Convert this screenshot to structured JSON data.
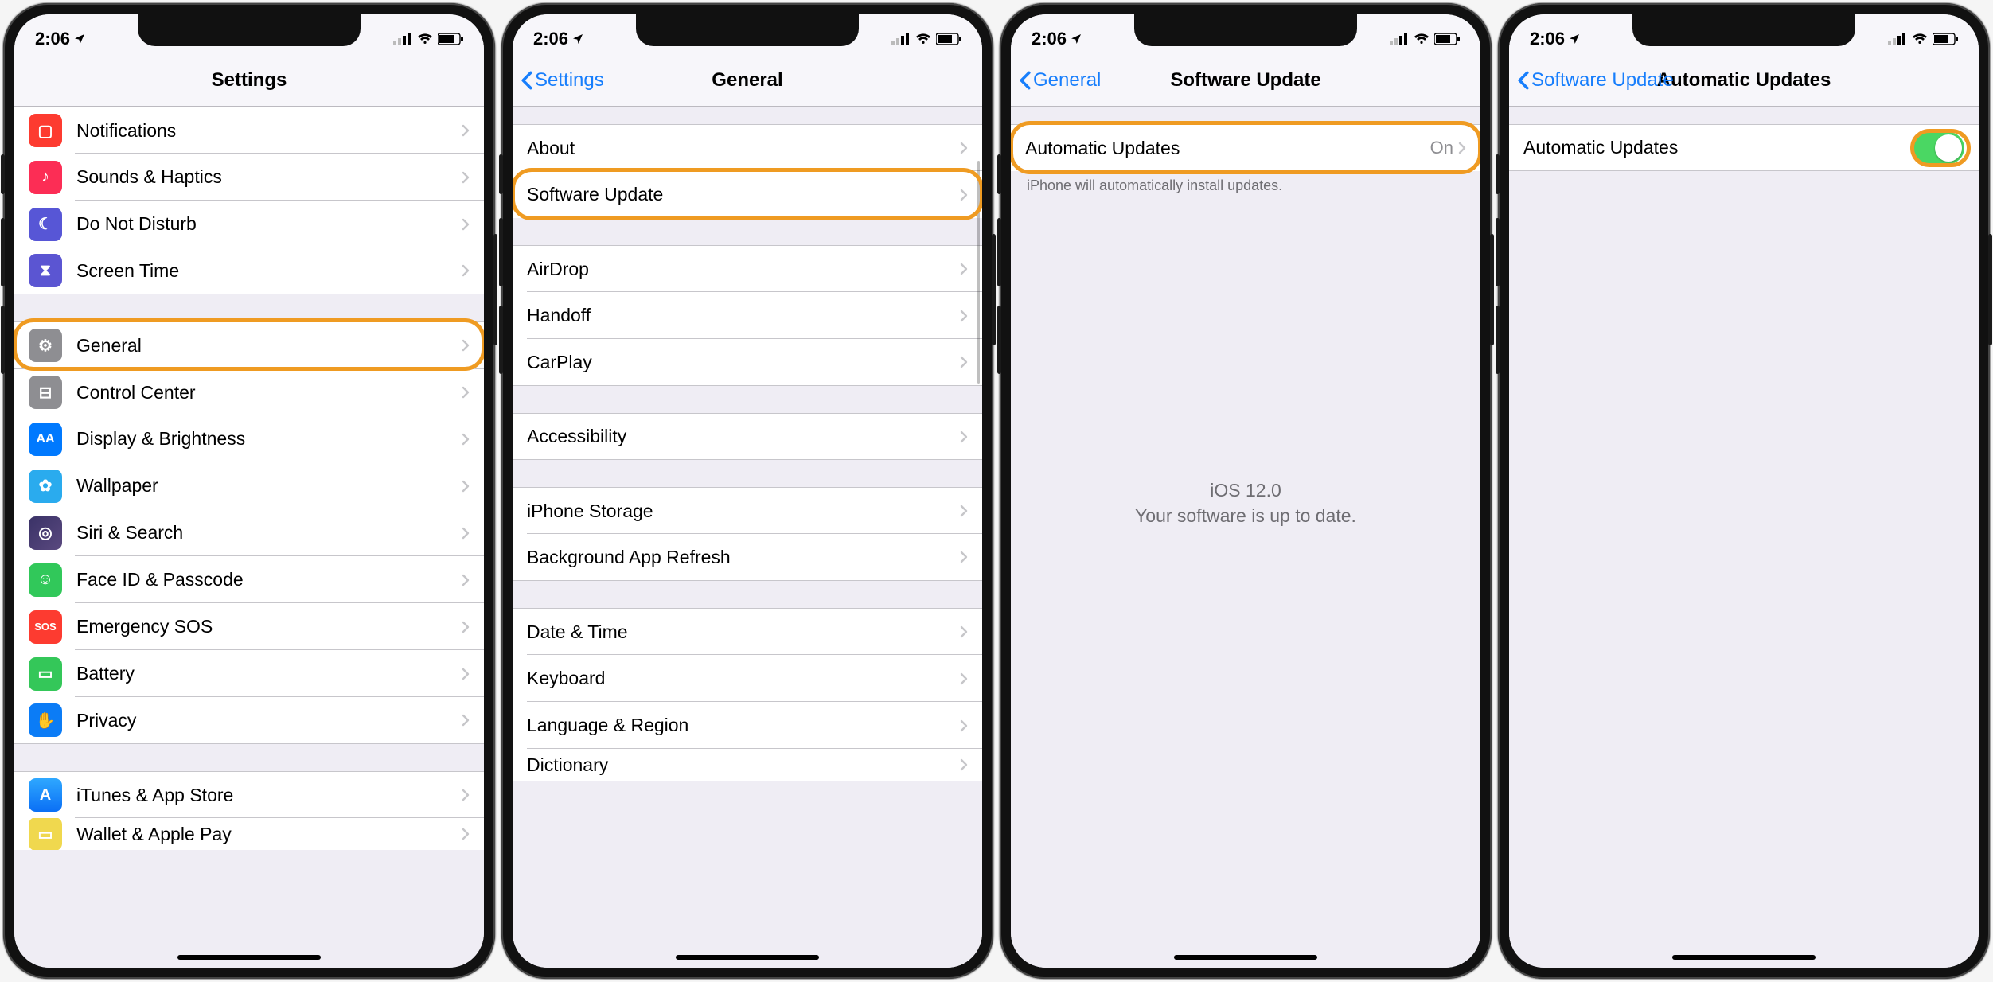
{
  "status": {
    "time": "2:06"
  },
  "screens": [
    {
      "title": "Settings",
      "back": null,
      "groups": [
        {
          "rows": [
            {
              "icon": "notifications-icon",
              "label": "Notifications",
              "color": "ic-red"
            },
            {
              "icon": "sounds-icon",
              "label": "Sounds & Haptics",
              "color": "ic-pink"
            },
            {
              "icon": "dnd-icon",
              "label": "Do Not Disturb",
              "color": "ic-purple"
            },
            {
              "icon": "screentime-icon",
              "label": "Screen Time",
              "color": "ic-purple2"
            }
          ]
        },
        {
          "rows": [
            {
              "icon": "general-icon",
              "label": "General",
              "color": "ic-gray",
              "highlight": true
            },
            {
              "icon": "control-icon",
              "label": "Control Center",
              "color": "ic-gray"
            },
            {
              "icon": "display-icon",
              "label": "Display & Brightness",
              "color": "ic-blue"
            },
            {
              "icon": "wallpaper-icon",
              "label": "Wallpaper",
              "color": "ic-cyan"
            },
            {
              "icon": "siri-icon",
              "label": "Siri & Search",
              "color": "ic-dkpurple"
            },
            {
              "icon": "faceid-icon",
              "label": "Face ID & Passcode",
              "color": "ic-green"
            },
            {
              "icon": "sos-icon",
              "label": "Emergency SOS",
              "color": "ic-red"
            },
            {
              "icon": "battery-icon",
              "label": "Battery",
              "color": "ic-green2"
            },
            {
              "icon": "privacy-icon",
              "label": "Privacy",
              "color": "ic-dkblue"
            }
          ]
        },
        {
          "rows": [
            {
              "icon": "appstore-icon",
              "label": "iTunes & App Store",
              "color": "ic-store"
            },
            {
              "icon": "wallet-icon",
              "label": "Wallet & Apple Pay",
              "color": "ic-sand",
              "cut": true
            }
          ]
        }
      ]
    },
    {
      "title": "General",
      "back": "Settings",
      "groups": [
        {
          "rows": [
            {
              "label": "About"
            },
            {
              "label": "Software Update",
              "highlight": true
            }
          ]
        },
        {
          "rows": [
            {
              "label": "AirDrop"
            },
            {
              "label": "Handoff"
            },
            {
              "label": "CarPlay"
            }
          ]
        },
        {
          "rows": [
            {
              "label": "Accessibility"
            }
          ]
        },
        {
          "rows": [
            {
              "label": "iPhone Storage"
            },
            {
              "label": "Background App Refresh"
            }
          ]
        },
        {
          "rows": [
            {
              "label": "Date & Time"
            },
            {
              "label": "Keyboard"
            },
            {
              "label": "Language & Region"
            },
            {
              "label": "Dictionary",
              "cut": true
            }
          ]
        }
      ],
      "scrollbar": true
    },
    {
      "title": "Software Update",
      "back": "General",
      "auto_row": {
        "label": "Automatic Updates",
        "value": "On",
        "highlight": true
      },
      "footer": "iPhone will automatically install updates.",
      "status_version": "iOS 12.0",
      "status_msg": "Your software is up to date."
    },
    {
      "title": "Automatic Updates",
      "back": "Software Update",
      "toggle_row": {
        "label": "Automatic Updates",
        "on": true,
        "highlight": true
      }
    }
  ]
}
